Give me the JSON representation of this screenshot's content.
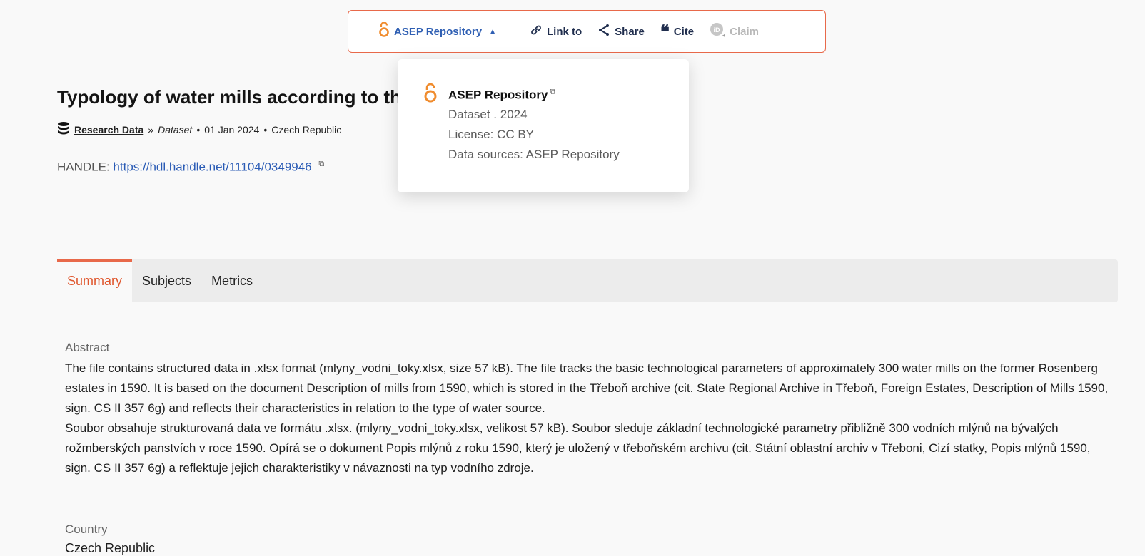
{
  "actionbar": {
    "repository_label": "ASEP Repository",
    "link_label": "Link to",
    "share_label": "Share",
    "cite_label": "Cite",
    "claim_label": "Claim"
  },
  "popover": {
    "title": "ASEP Repository",
    "type_year": "Dataset . 2024",
    "license": "License: CC BY",
    "sources": "Data sources: ASEP Repository"
  },
  "record": {
    "title": "Typology of water mills according to th",
    "category": "Research Data",
    "subtype": "Dataset",
    "date": "01 Jan 2024",
    "country": "Czech Republic",
    "handle_label": "HANDLE:",
    "handle_url": "https://hdl.handle.net/11104/0349946"
  },
  "tabs": [
    "Summary",
    "Subjects",
    "Metrics"
  ],
  "summary": {
    "abstract_label": "Abstract",
    "abstract_en": "The file contains structured data in .xlsx format (mlyny_vodni_toky.xlsx, size 57 kB). The file tracks the basic technological parameters of approximately 300 water mills on the former Rosenberg estates in 1590. It is based on the document Description of mills from 1590, which is stored in the Třeboň archive (cit. State Regional Archive in Třeboň, Foreign Estates, Description of Mills 1590, sign. CS II 357 6g) and reflects their characteristics in relation to the type of water source.",
    "abstract_cs": "Soubor obsahuje strukturovaná data ve formátu .xlsx. (mlyny_vodni_toky.xlsx, velikost 57 kB). Soubor sleduje základní technologické parametry přibližně 300 vodních mlýnů na bývalých rožmberských panstvích v roce 1590. Opírá se o dokument Popis mlýnů z roku 1590, který je uložený v třeboňském archivu (cit. Státní oblastní archiv v Třeboni, Cizí statky, Popis mlýnů 1590, sign. CS II 357 6g) a reflektuje jejich charakteristiky v návaznosti na typ vodního zdroje.",
    "country_label": "Country",
    "country_value": "Czech Republic"
  },
  "colors": {
    "accent": "#e8694a",
    "link": "#2a5bb5",
    "repo_icon": "#f08c2e"
  }
}
